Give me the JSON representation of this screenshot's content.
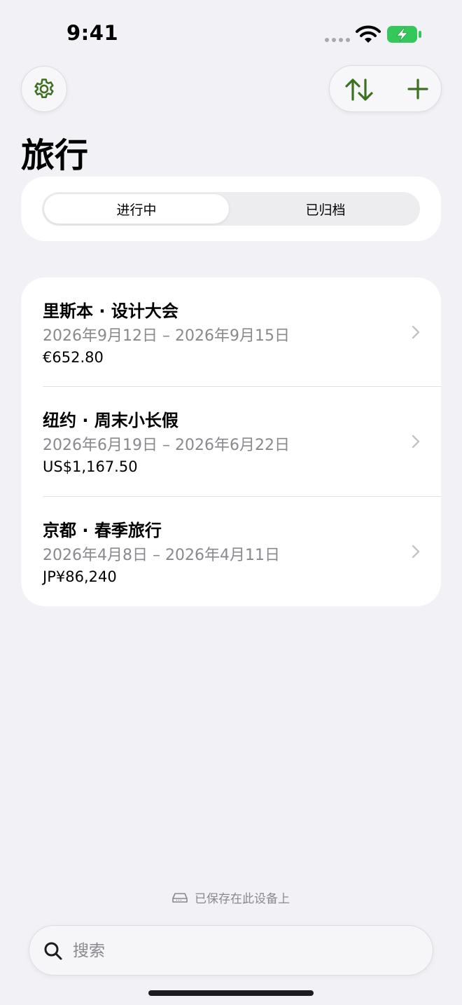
{
  "status_bar": {
    "time": "9:41"
  },
  "header": {
    "title": "旅行"
  },
  "segments": {
    "active": "进行中",
    "inactive": "已归档"
  },
  "trips": [
    {
      "name": "里斯本 · 设计大会",
      "dates": "2026年9月12日 – 2026年9月15日",
      "amount": "€652.80"
    },
    {
      "name": "纽约 · 周末小长假",
      "dates": "2026年6月19日 – 2026年6月22日",
      "amount": "US$1,167.50"
    },
    {
      "name": "京都 · 春季旅行",
      "dates": "2026年4月8日 – 2026年4月11日",
      "amount": "JP¥86,240"
    }
  ],
  "footer": {
    "saved_text": "已保存在此设备上"
  },
  "search": {
    "placeholder": "搜索"
  },
  "colors": {
    "accent": "#3e7021",
    "battery": "#34c759",
    "background": "#f1f1f6"
  }
}
